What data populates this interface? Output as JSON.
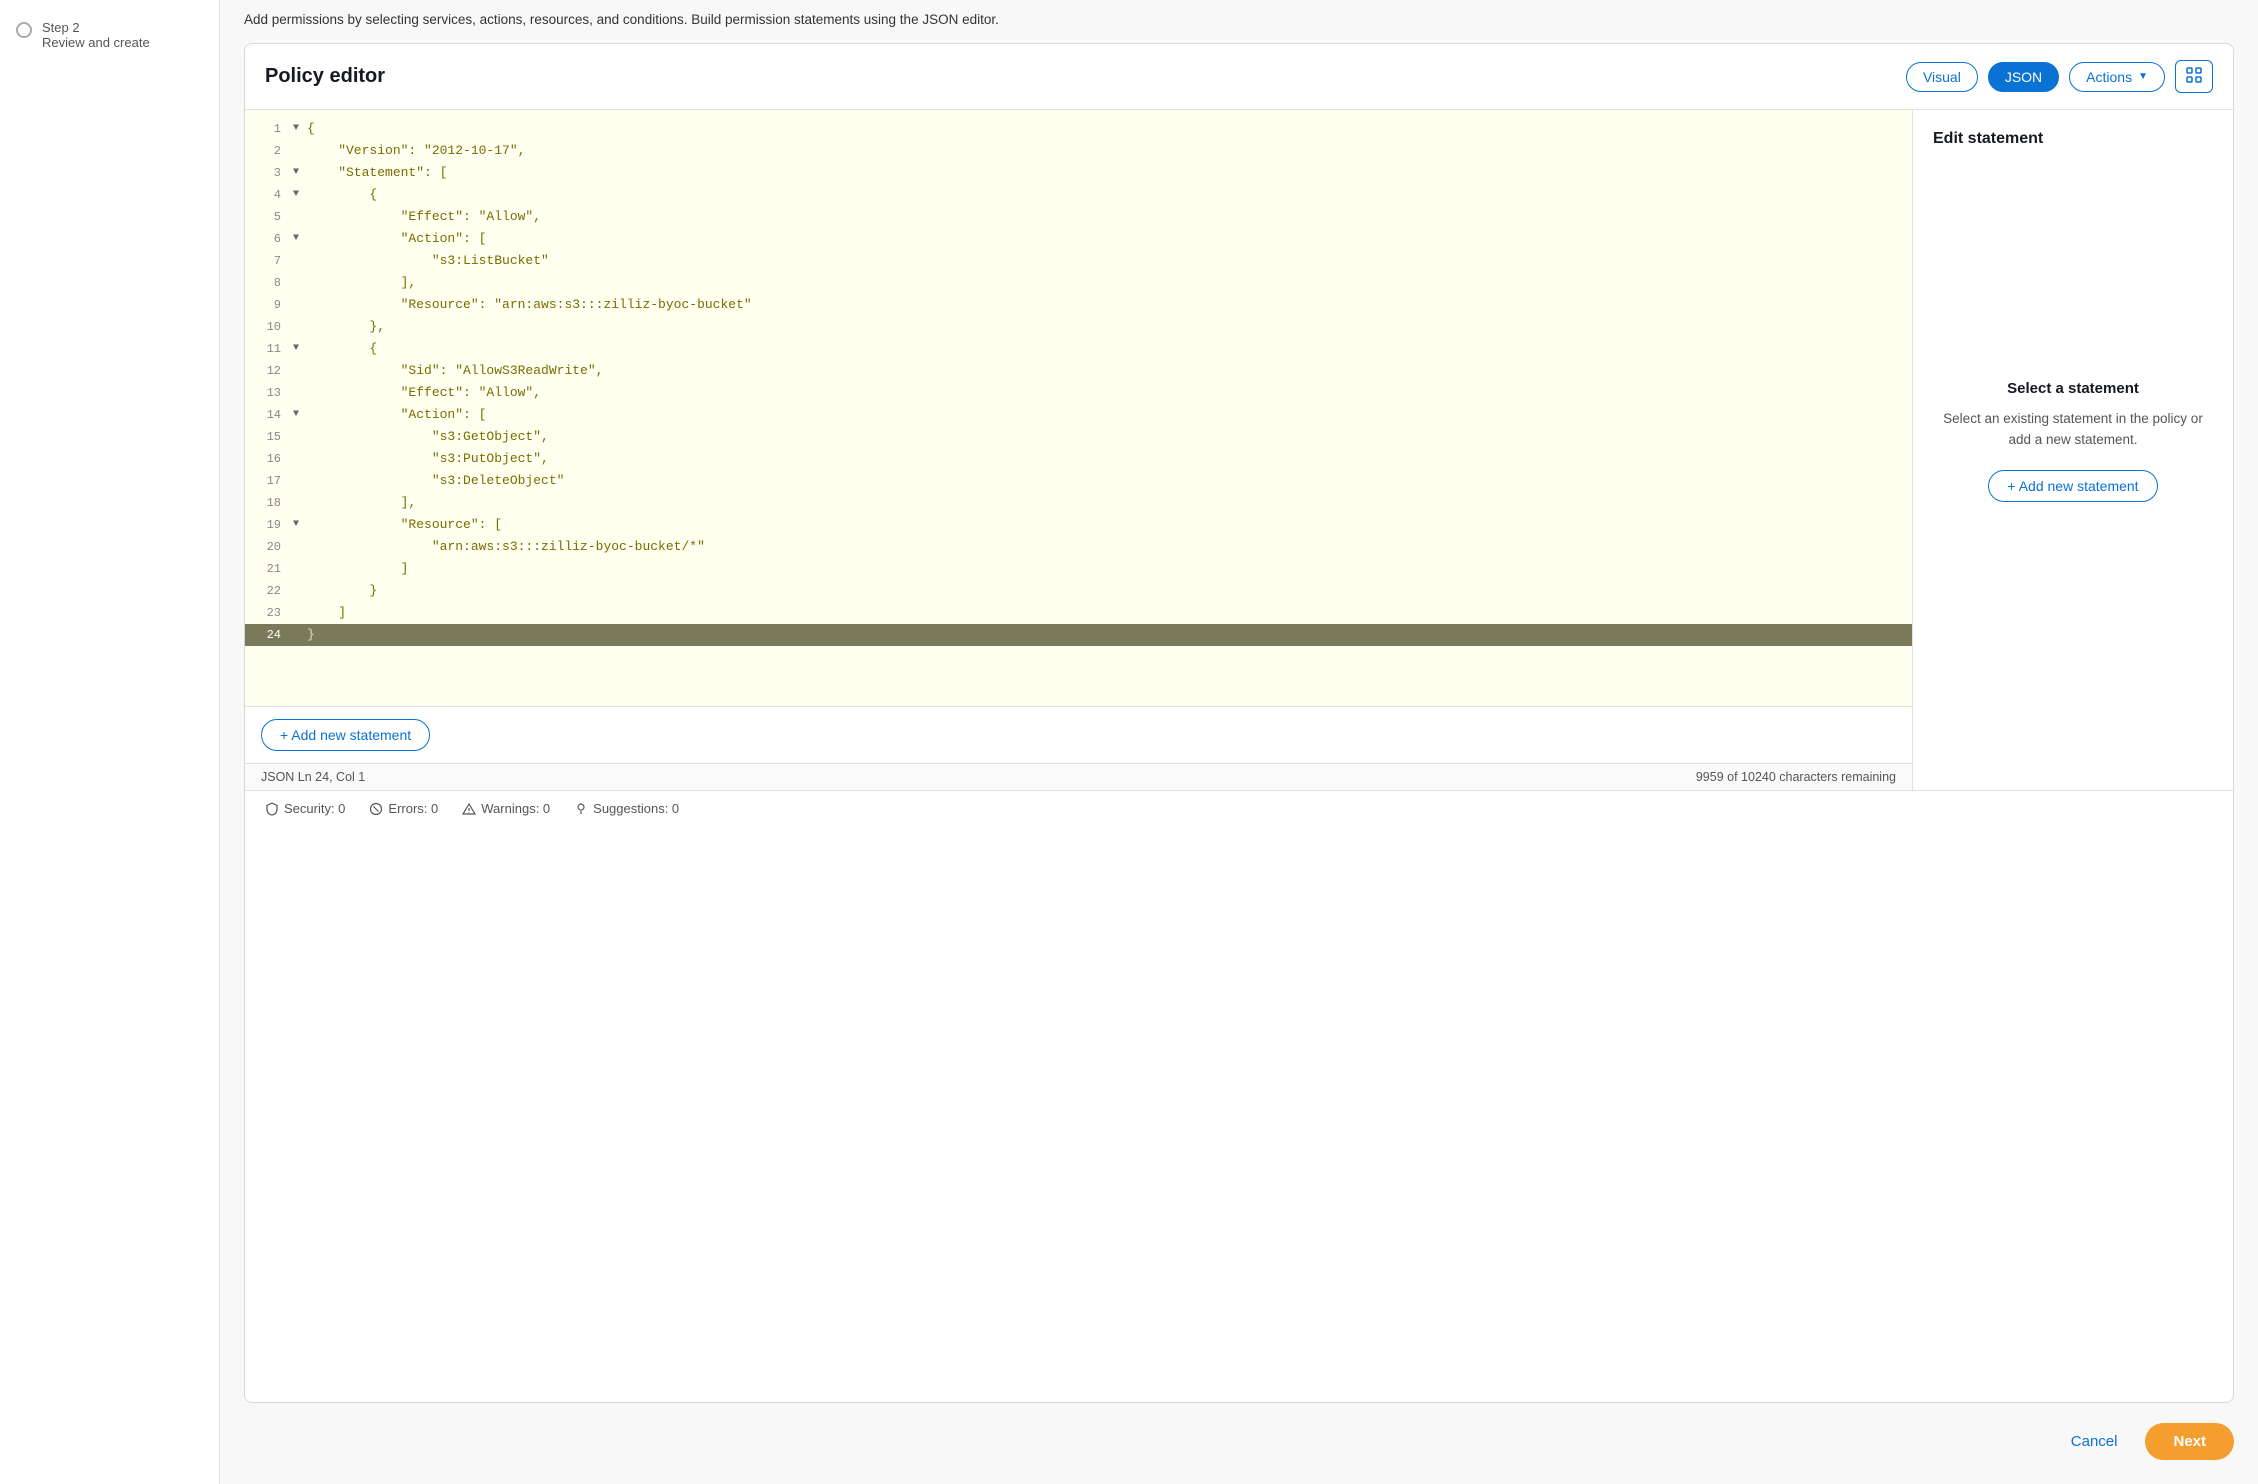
{
  "page": {
    "description": "Add permissions by selecting services, actions, resources, and conditions. Build permission statements using the JSON editor."
  },
  "sidebar": {
    "step2_label": "Step 2",
    "review_create": "Review and create"
  },
  "policy_editor": {
    "title": "Policy editor",
    "btn_visual": "Visual",
    "btn_json": "JSON",
    "btn_actions": "Actions",
    "code_lines": [
      {
        "num": "1",
        "toggle": "▼",
        "code": "{"
      },
      {
        "num": "2",
        "toggle": "",
        "code": "    \"Version\": \"2012-10-17\","
      },
      {
        "num": "3",
        "toggle": "▼",
        "code": "    \"Statement\": ["
      },
      {
        "num": "4",
        "toggle": "▼",
        "code": "        {"
      },
      {
        "num": "5",
        "toggle": "",
        "code": "            \"Effect\": \"Allow\","
      },
      {
        "num": "6",
        "toggle": "▼",
        "code": "            \"Action\": ["
      },
      {
        "num": "7",
        "toggle": "",
        "code": "                \"s3:ListBucket\""
      },
      {
        "num": "8",
        "toggle": "",
        "code": "            ],"
      },
      {
        "num": "9",
        "toggle": "",
        "code": "            \"Resource\": \"arn:aws:s3:::zilliz-byoc-bucket\""
      },
      {
        "num": "10",
        "toggle": "",
        "code": "        },"
      },
      {
        "num": "11",
        "toggle": "▼",
        "code": "        {"
      },
      {
        "num": "12",
        "toggle": "",
        "code": "            \"Sid\": \"AllowS3ReadWrite\","
      },
      {
        "num": "13",
        "toggle": "",
        "code": "            \"Effect\": \"Allow\","
      },
      {
        "num": "14",
        "toggle": "▼",
        "code": "            \"Action\": ["
      },
      {
        "num": "15",
        "toggle": "",
        "code": "                \"s3:GetObject\","
      },
      {
        "num": "16",
        "toggle": "",
        "code": "                \"s3:PutObject\","
      },
      {
        "num": "17",
        "toggle": "",
        "code": "                \"s3:DeleteObject\""
      },
      {
        "num": "18",
        "toggle": "",
        "code": "            ],"
      },
      {
        "num": "19",
        "toggle": "▼",
        "code": "            \"Resource\": ["
      },
      {
        "num": "20",
        "toggle": "",
        "code": "                \"arn:aws:s3:::zilliz-byoc-bucket/*\""
      },
      {
        "num": "21",
        "toggle": "",
        "code": "            ]"
      },
      {
        "num": "22",
        "toggle": "",
        "code": "        }"
      },
      {
        "num": "23",
        "toggle": "",
        "code": "    ]"
      },
      {
        "num": "24",
        "toggle": "",
        "code": "}",
        "highlighted": true
      }
    ],
    "add_statement_label": "+ Add new statement",
    "status_left": "JSON   Ln 24, Col 1",
    "status_right": "9959 of 10240 characters remaining"
  },
  "edit_statement_panel": {
    "title": "Edit statement",
    "select_heading": "Select a statement",
    "select_desc": "Select an existing statement in the policy or add a new statement.",
    "add_new_label": "+ Add new statement"
  },
  "diagnostics": {
    "security_label": "Security: 0",
    "errors_label": "Errors: 0",
    "warnings_label": "Warnings: 0",
    "suggestions_label": "Suggestions: 0"
  },
  "footer": {
    "cancel_label": "Cancel",
    "next_label": "Next"
  }
}
